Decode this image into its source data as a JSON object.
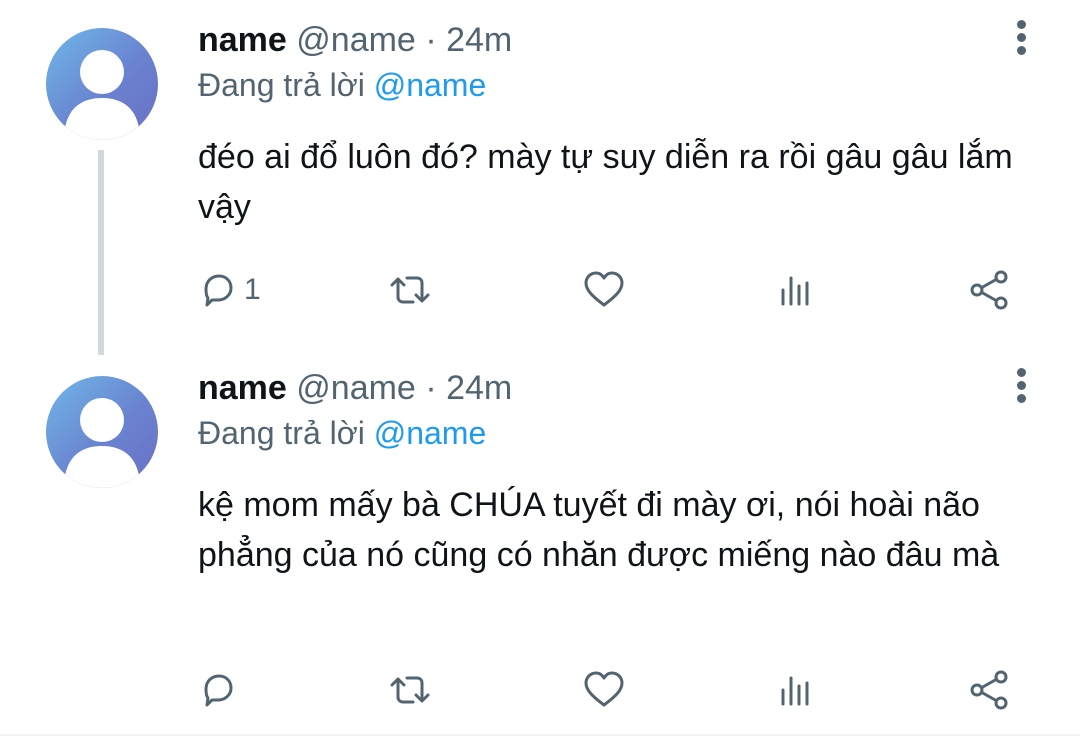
{
  "tweets": [
    {
      "display_name": "name",
      "handle": "@name",
      "separator": "·",
      "time": "24m",
      "reply_prefix": "Đang trả lời",
      "reply_handle": "@name",
      "text": "đéo ai đổ luôn đó? mày tự suy diễn ra rồi gâu gâu lắm vậy",
      "reply_count": "1"
    },
    {
      "display_name": "name",
      "handle": "@name",
      "separator": "·",
      "time": "24m",
      "reply_prefix": "Đang trả lời",
      "reply_handle": "@name",
      "text": "kệ mom mấy bà CHÚA tuyết đi mày ơi, nói hoài não phẳng của nó cũng có nhăn được miếng nào đâu mà",
      "reply_count": ""
    }
  ],
  "icons": [
    "avatar-placeholder-icon",
    "more-options-icon",
    "reply-icon",
    "retweet-icon",
    "like-icon",
    "views-icon",
    "share-icon"
  ],
  "colors": {
    "text": "#0f1419",
    "secondary": "#536471",
    "link": "#1d9bf0",
    "thread_line": "#cfd9de"
  }
}
